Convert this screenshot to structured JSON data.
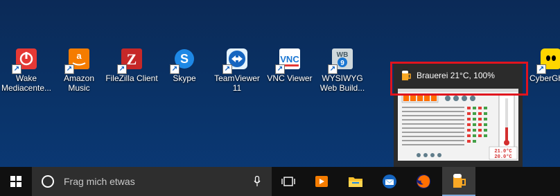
{
  "desktop": {
    "icons": [
      {
        "label": "Wake Mediacente...",
        "icon": "wake-icon",
        "color": "#e53935"
      },
      {
        "label": "Amazon Music",
        "icon": "amazon-music-icon",
        "color": "#f57c00"
      },
      {
        "label": "FileZilla Client",
        "icon": "filezilla-icon",
        "color": "#c62828"
      },
      {
        "label": "Skype",
        "icon": "skype-icon",
        "color": "#1e88e5"
      },
      {
        "label": "TeamViewer 11",
        "icon": "teamviewer-icon",
        "color": "#1565c0"
      },
      {
        "label": "VNC Viewer",
        "icon": "vnc-viewer-icon",
        "color": "#1976d2"
      },
      {
        "label": "WYSIWYG Web Build...",
        "icon": "wysiwyg-web-builder-icon",
        "color": "#90a4ae"
      },
      {
        "label": "CyberGh",
        "icon": "cyberghost-icon",
        "color": "#ffd600"
      }
    ]
  },
  "preview": {
    "title": "Brauerei 21°C, 100%",
    "icon": "beer-mug-icon",
    "thumbnail": {
      "temp1": "21.0°C",
      "temp2": "20.0°C"
    }
  },
  "taskbar": {
    "search_placeholder": "Frag mich etwas",
    "items": [
      "start-icon",
      "task-view-icon",
      "media-player-icon",
      "file-explorer-icon",
      "thunderbird-icon",
      "firefox-icon",
      "brauerei-icon"
    ],
    "active_item": "brauerei-icon"
  },
  "colors": {
    "highlight": "#e0141e",
    "taskbar": "#101010",
    "search_box": "#2e2e2e"
  }
}
